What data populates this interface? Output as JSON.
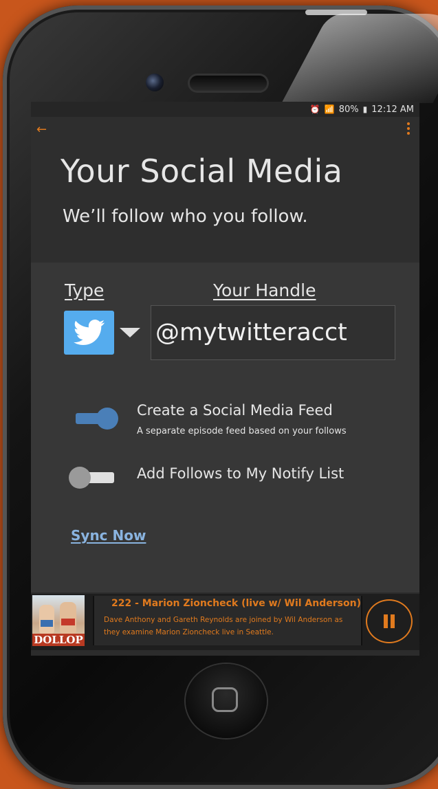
{
  "status_bar": {
    "battery": "80%",
    "time": "12:12 AM"
  },
  "header": {
    "title": "Your Social Media",
    "subtitle": "We’ll follow who you follow."
  },
  "form": {
    "type_label": "Type",
    "handle_label": "Your Handle",
    "selected_type_icon": "twitter-icon",
    "handle_value": "@mytwitteracct"
  },
  "options": [
    {
      "label": "Create a Social Media Feed",
      "sublabel": "A separate episode feed based on your follows",
      "enabled": true
    },
    {
      "label": "Add Follows to My Notify List",
      "enabled": false
    }
  ],
  "sync_link": "Sync Now",
  "player": {
    "episode_title": "222 - Marion Zioncheck (live w/ Wil Anderson)",
    "episode_description": "Dave Anthony and Gareth Reynolds are joined by Wil Anderson as they examine Marion Zioncheck live in Seattle.",
    "album_logo_text": "DOLLOP",
    "state": "playing"
  },
  "colors": {
    "accent": "#e07a1e",
    "toggle_on": "#4a7fb8",
    "link": "#8ab4e0",
    "twitter": "#55acee"
  }
}
